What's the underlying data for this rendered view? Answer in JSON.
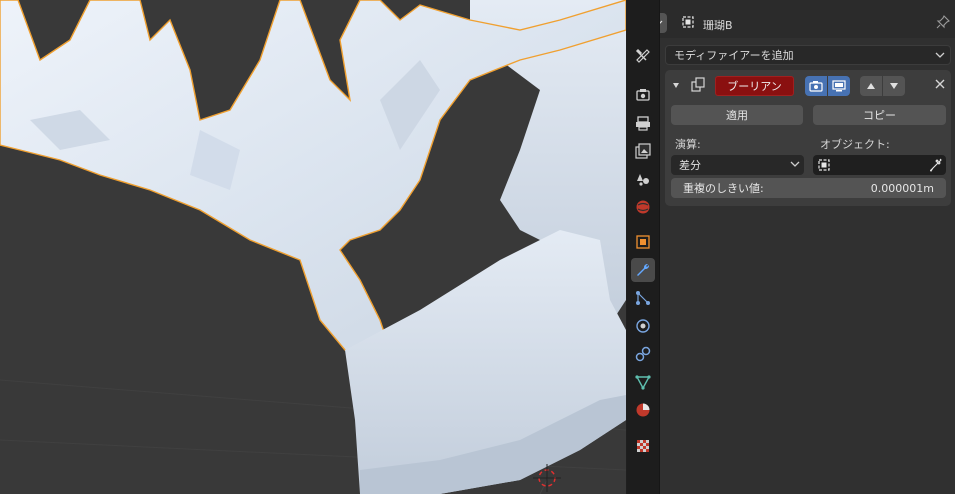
{
  "header": {
    "object_name": "珊瑚B"
  },
  "add_modifier": {
    "label": "モディファイアーを追加"
  },
  "modifier": {
    "name": "ブーリアン",
    "apply_label": "適用",
    "copy_label": "コピー",
    "operation_label": "演算:",
    "operation_value": "差分",
    "object_label": "オブジェクト:",
    "object_value": "",
    "threshold_label": "重複のしきい値:",
    "threshold_value": "0.000001m"
  },
  "tabs": [
    "tool-icon",
    "render-icon",
    "output-icon",
    "view-layer-icon",
    "scene-icon",
    "world-icon",
    "object-icon",
    "modifier-icon",
    "particles-icon",
    "physics-icon",
    "constraints-icon",
    "data-icon",
    "material-icon",
    "texture-icon"
  ],
  "colors": {
    "accent_blue": "#4772b3",
    "modifier_name_bg": "#8a1010",
    "selection_outline": "#f0a030",
    "active_tab_icon": "#63a8ff"
  }
}
